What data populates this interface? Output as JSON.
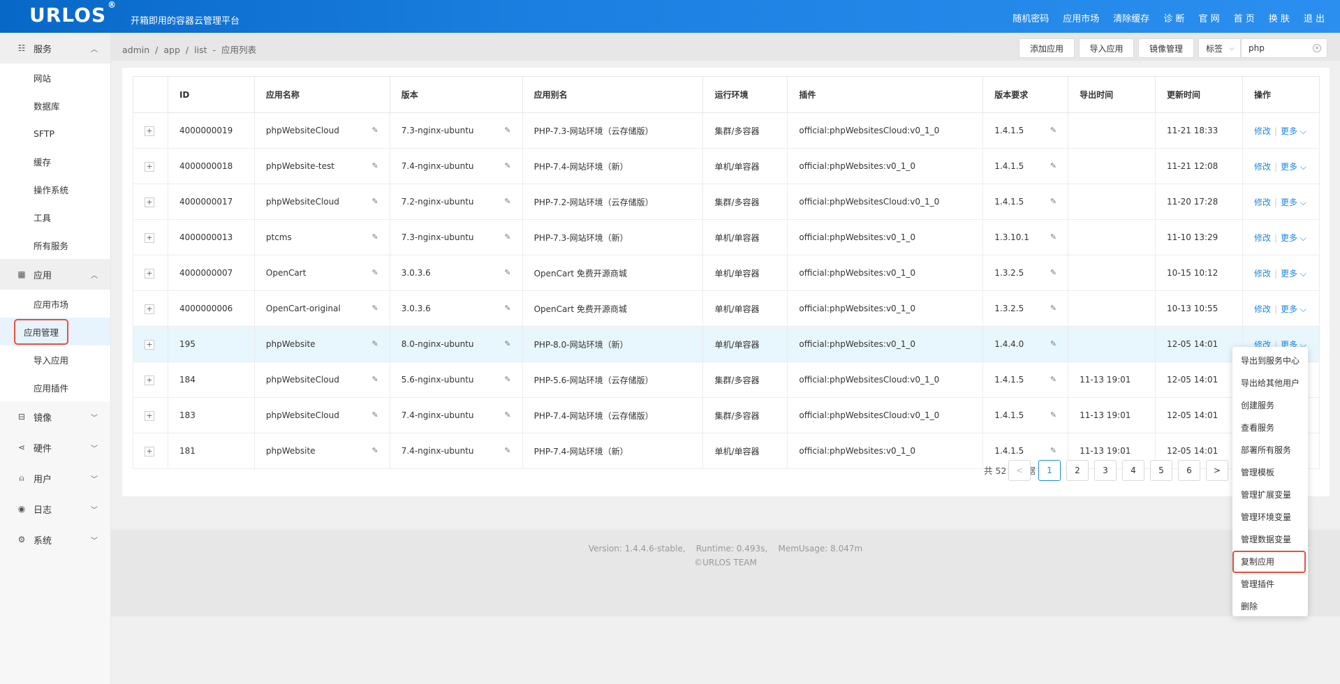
{
  "header": {
    "logo": "URLOS",
    "logo_mark": "®",
    "slogan": "开箱即用的容器云管理平台",
    "nav": [
      "随机密码",
      "应用市场",
      "清除缓存",
      "诊 断",
      "官 网",
      "首 页",
      "换 肤",
      "退 出"
    ]
  },
  "sidebar": {
    "groups": [
      {
        "label": "服务",
        "icon": "service-icon",
        "expanded": true,
        "items": [
          "网站",
          "数据库",
          "SFTP",
          "缓存",
          "操作系统",
          "工具",
          "所有服务"
        ]
      },
      {
        "label": "应用",
        "icon": "app-icon",
        "expanded": true,
        "items": [
          "应用市场",
          "应用管理",
          "导入应用",
          "应用插件"
        ]
      },
      {
        "label": "镜像",
        "icon": "image-icon",
        "expanded": false
      },
      {
        "label": "硬件",
        "icon": "hardware-icon",
        "expanded": false
      },
      {
        "label": "用户",
        "icon": "user-icon",
        "expanded": false
      },
      {
        "label": "日志",
        "icon": "log-icon",
        "expanded": false
      },
      {
        "label": "系统",
        "icon": "system-icon",
        "expanded": false
      }
    ],
    "active_item": "应用管理"
  },
  "breadcrumb": {
    "parts": [
      "admin",
      "/",
      "app",
      "/",
      "list",
      "-",
      "应用列表"
    ]
  },
  "toolbar": {
    "add_app": "添加应用",
    "import_app": "导入应用",
    "image_mgmt": "镜像管理",
    "tag_select": "标签",
    "search_value": "php"
  },
  "table": {
    "columns": [
      "",
      "ID",
      "应用名称",
      "版本",
      "应用别名",
      "运行环境",
      "插件",
      "版本要求",
      "导出时间",
      "更新时间",
      "操作"
    ],
    "rows": [
      [
        "+",
        "4000000019",
        "phpWebsiteCloud",
        "7.3-nginx-ubuntu",
        "PHP-7.3-网站环境（云存储版）",
        "集群/多容器",
        "official:phpWebsitesCloud:v0_1_0",
        "1.4.1.5",
        "",
        "11-21 18:33"
      ],
      [
        "+",
        "4000000018",
        "phpWebsite-test",
        "7.4-nginx-ubuntu",
        "PHP-7.4-网站环境（新）",
        "单机/单容器",
        "official:phpWebsites:v0_1_0",
        "1.4.1.5",
        "",
        "11-21 12:08"
      ],
      [
        "+",
        "4000000017",
        "phpWebsiteCloud",
        "7.2-nginx-ubuntu",
        "PHP-7.2-网站环境（云存储版）",
        "集群/多容器",
        "official:phpWebsitesCloud:v0_1_0",
        "1.4.1.5",
        "",
        "11-20 17:28"
      ],
      [
        "+",
        "4000000013",
        "ptcms",
        "7.3-nginx-ubuntu",
        "PHP-7.3-网站环境（新）",
        "单机/单容器",
        "official:phpWebsites:v0_1_0",
        "1.3.10.1",
        "",
        "11-10 13:29"
      ],
      [
        "+",
        "4000000007",
        "OpenCart",
        "3.0.3.6",
        "OpenCart 免费开源商城",
        "单机/单容器",
        "official:phpWebsites:v0_1_0",
        "1.3.2.5",
        "",
        "10-15 10:12"
      ],
      [
        "+",
        "4000000006",
        "OpenCart-original",
        "3.0.3.6",
        "OpenCart 免费开源商城",
        "单机/单容器",
        "official:phpWebsites:v0_1_0",
        "1.3.2.5",
        "",
        "10-13 10:55"
      ],
      [
        "+",
        "195",
        "phpWebsite",
        "8.0-nginx-ubuntu",
        "PHP-8.0-网站环境（新）",
        "单机/单容器",
        "official:phpWebsites:v0_1_0",
        "1.4.4.0",
        "",
        "12-05 14:01"
      ],
      [
        "+",
        "184",
        "phpWebsiteCloud",
        "5.6-nginx-ubuntu",
        "PHP-5.6-网站环境（云存储版）",
        "集群/多容器",
        "official:phpWebsitesCloud:v0_1_0",
        "1.4.1.5",
        "11-13 19:01",
        "12-05 14:01"
      ],
      [
        "+",
        "183",
        "phpWebsiteCloud",
        "7.4-nginx-ubuntu",
        "PHP-7.4-网站环境（云存储版）",
        "集群/多容器",
        "official:phpWebsitesCloud:v0_1_0",
        "1.4.1.5",
        "11-13 19:01",
        "12-05 14:01"
      ],
      [
        "+",
        "181",
        "phpWebsite",
        "7.4-nginx-ubuntu",
        "PHP-7.4-网站环境（新）",
        "单机/单容器",
        "official:phpWebsites:v0_1_0",
        "1.4.1.5",
        "11-13 19:01",
        "12-05 14:01"
      ]
    ],
    "op_edit": "修改",
    "op_more": "更多",
    "highlighted_row": 6
  },
  "pagination": {
    "total": "共 52 条数据",
    "pages": [
      "1",
      "2",
      "3",
      "4",
      "5",
      "6"
    ],
    "current": "1",
    "prev": "<",
    "next": ">"
  },
  "footer": {
    "line1": "Version: 1.4.4.6-stable,    Runtime: 0.493s,    MemUsage: 8.047m",
    "line2": "©URLOS TEAM"
  },
  "dropdown": {
    "items": [
      "导出到服务中心",
      "导出给其他用户",
      "创建服务",
      "查看服务",
      "部署所有服务",
      "管理模板",
      "管理扩展变量",
      "管理环境变量",
      "管理数据变量",
      "复制应用",
      "管理插件",
      "删除"
    ],
    "boxed": "复制应用"
  },
  "colors": {
    "accent": "#1e88e5",
    "highlight_box": "#e8503e",
    "header": "#1a7fe0"
  }
}
